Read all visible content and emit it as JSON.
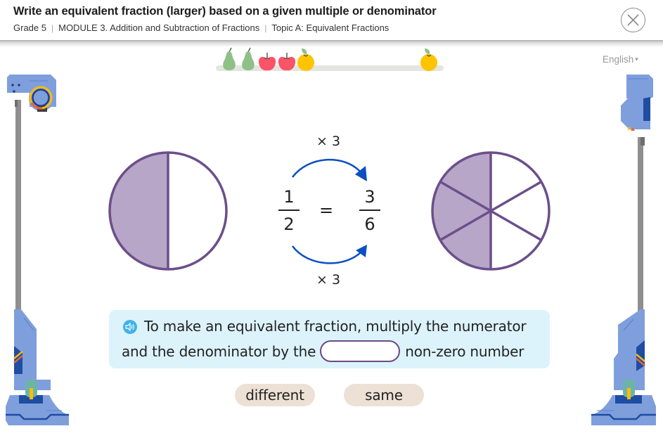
{
  "header": {
    "title": "Write an equivalent fraction (larger) based on a given multiple or denominator",
    "breadcrumb": [
      "Grade 5",
      "MODULE 3. Addition and Subtraction of Fractions",
      "Topic A: Equivalent Fractions"
    ],
    "close_icon": "close-circle-icon"
  },
  "language": {
    "selected": "English",
    "caret": "▾"
  },
  "progress": {
    "fruits": [
      "pear",
      "pear",
      "apple",
      "apple",
      "orange"
    ],
    "goal_fruit": "orange",
    "completed": 5
  },
  "equation": {
    "multiplier_top": "× 3",
    "multiplier_bottom": "× 3",
    "left_fraction": {
      "numerator": "1",
      "denominator": "2"
    },
    "equals": "=",
    "right_fraction": {
      "numerator": "3",
      "denominator": "6"
    }
  },
  "models": {
    "left": {
      "parts": 2,
      "shaded": 1
    },
    "right": {
      "parts": 6,
      "shaded": 3
    },
    "fill_color": "#b7a6c8",
    "stroke_color": "#6b4f8a"
  },
  "prompt": {
    "speaker_icon": "speaker-icon",
    "line1": "To make an equivalent fraction, multiply the numerator",
    "line2_before": "and the denominator by the",
    "blank_value": "",
    "line2_after": "non-zero number"
  },
  "choices": [
    {
      "label": "different"
    },
    {
      "label": "same"
    }
  ],
  "colors": {
    "accent_blue": "#0b4fc0",
    "prompt_bg": "#ddf3fb",
    "choice_bg": "#ede1d6",
    "machine_blue": "#7f9fdc"
  }
}
